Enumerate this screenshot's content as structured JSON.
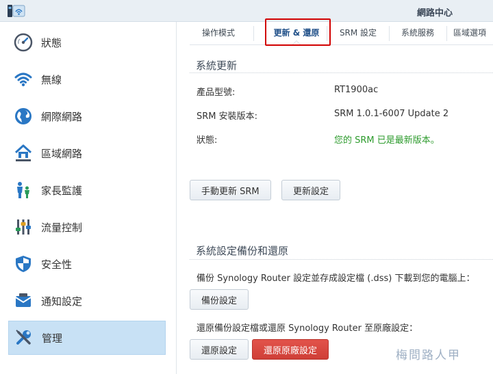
{
  "window": {
    "title": "網路中心"
  },
  "sidebar": {
    "items": [
      {
        "label": "狀態",
        "icon": "gauge-icon"
      },
      {
        "label": "無線",
        "icon": "wifi-icon"
      },
      {
        "label": "網際網路",
        "icon": "globe-icon"
      },
      {
        "label": "區域網路",
        "icon": "home-network-icon"
      },
      {
        "label": "家長監護",
        "icon": "family-icon"
      },
      {
        "label": "流量控制",
        "icon": "sliders-icon"
      },
      {
        "label": "安全性",
        "icon": "shield-icon"
      },
      {
        "label": "通知設定",
        "icon": "notification-icon"
      },
      {
        "label": "管理",
        "icon": "tools-icon",
        "active": true
      }
    ]
  },
  "tabs": [
    {
      "label": "操作模式"
    },
    {
      "label": "更新 & 還原",
      "active": true
    },
    {
      "label": "SRM 設定"
    },
    {
      "label": "系統服務"
    },
    {
      "label": "區域選項"
    }
  ],
  "update": {
    "title": "系統更新",
    "model_label": "產品型號:",
    "model_value": "RT1900ac",
    "version_label": "SRM 安裝版本:",
    "version_value": "SRM 1.0.1-6007 Update 2",
    "status_label": "狀態:",
    "status_value": "您的 SRM 已是最新版本。",
    "manual_update_button": "手動更新 SRM",
    "update_settings_button": "更新設定"
  },
  "backup": {
    "title": "系統設定備份和還原",
    "backup_desc": "備份 Synology Router 設定並存成設定檔 (.dss) 下載到您的電腦上：",
    "backup_button": "備份設定",
    "restore_desc": "還原備份設定檔或還原 Synology Router 至原廠設定：",
    "restore_button": "還原設定",
    "factory_button": "還原原廠設定"
  },
  "watermark": "梅問路人甲",
  "colors": {
    "accent": "#1f4f88",
    "success": "#2d9b2d",
    "danger": "#d9473f",
    "highlight": "#d10000",
    "active_nav": "#c8e1f5"
  }
}
